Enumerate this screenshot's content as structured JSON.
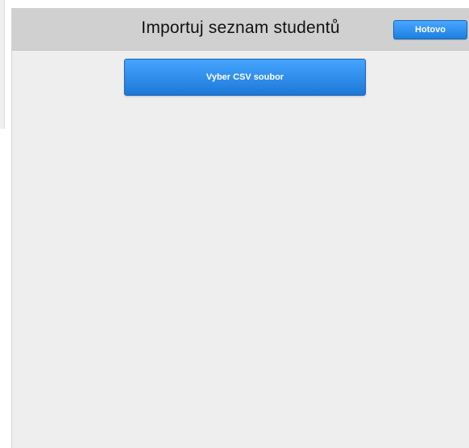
{
  "modal": {
    "title": "Importuj seznam studentů",
    "done_label": "Hotovo",
    "select_csv_label": "Vyber CSV soubor"
  },
  "colors": {
    "header_background": "#d0d0d0",
    "body_background": "#eeeeee",
    "button_blue": "#2a8ae8"
  }
}
